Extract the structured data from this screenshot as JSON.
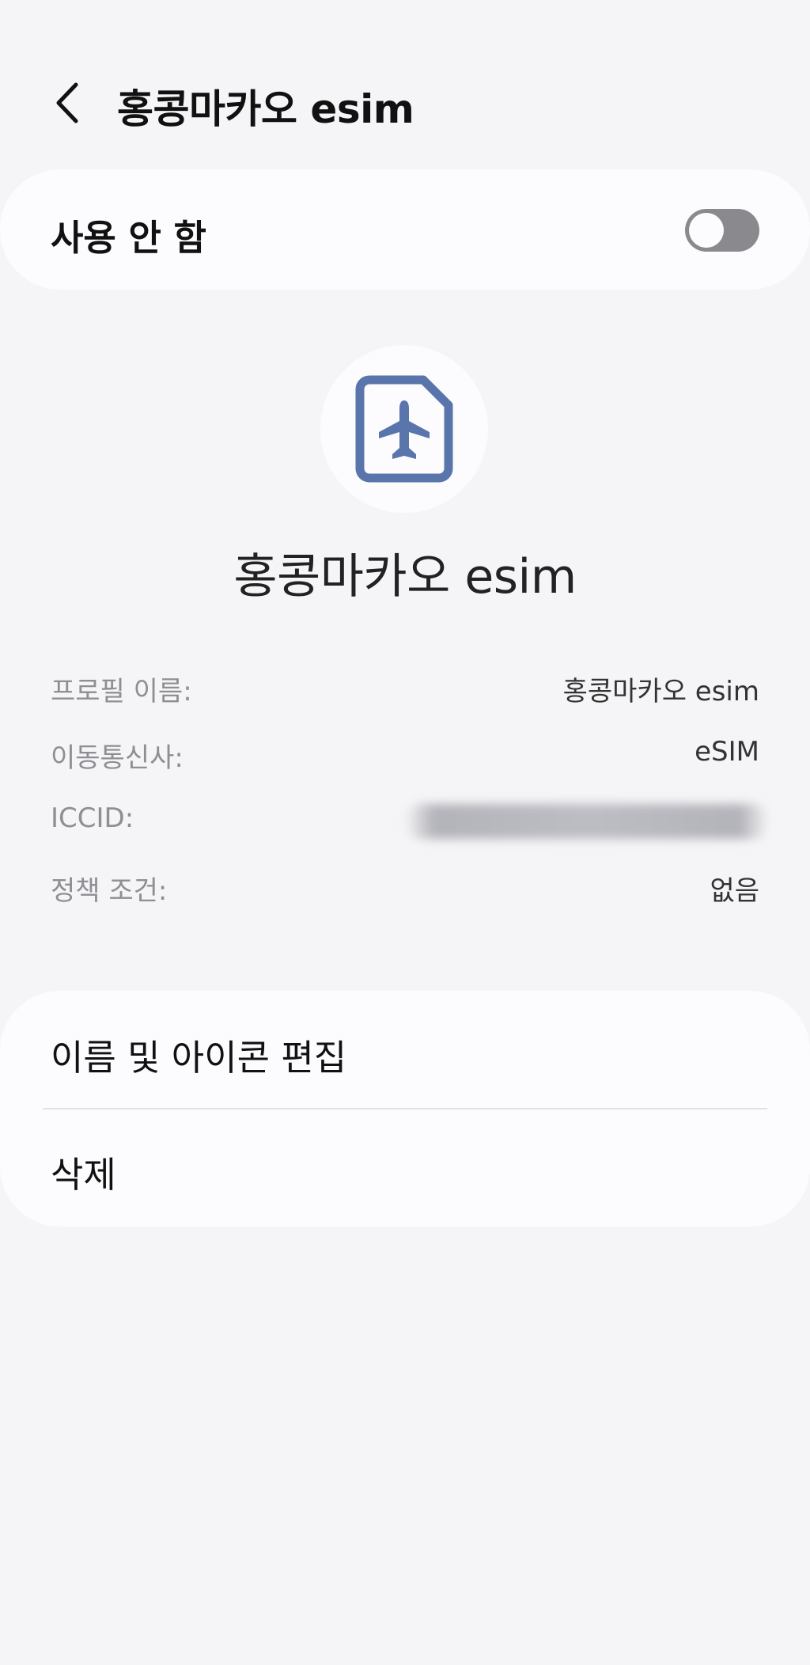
{
  "header": {
    "back_icon": "chevron-left-icon",
    "title": "홍콩마카오 esim"
  },
  "toggle": {
    "label": "사용 안 함",
    "state": "off"
  },
  "profile": {
    "icon": "esim-airplane-icon",
    "icon_color": "#5a75ac",
    "name": "홍콩마카오 esim"
  },
  "info": {
    "rows": [
      {
        "label": "프로필 이름:",
        "value": "홍콩마카오 esim"
      },
      {
        "label": "이동통신사:",
        "value": "eSIM"
      },
      {
        "label": "ICCID:",
        "value": ""
      },
      {
        "label": "정책 조건:",
        "value": "없음"
      }
    ]
  },
  "actions": {
    "edit_label": "이름 및 아이콘 편집",
    "delete_label": "삭제"
  },
  "colors": {
    "background": "#f5f5f7",
    "card": "#fcfcfe",
    "switch_off": "#8a8a8e"
  }
}
